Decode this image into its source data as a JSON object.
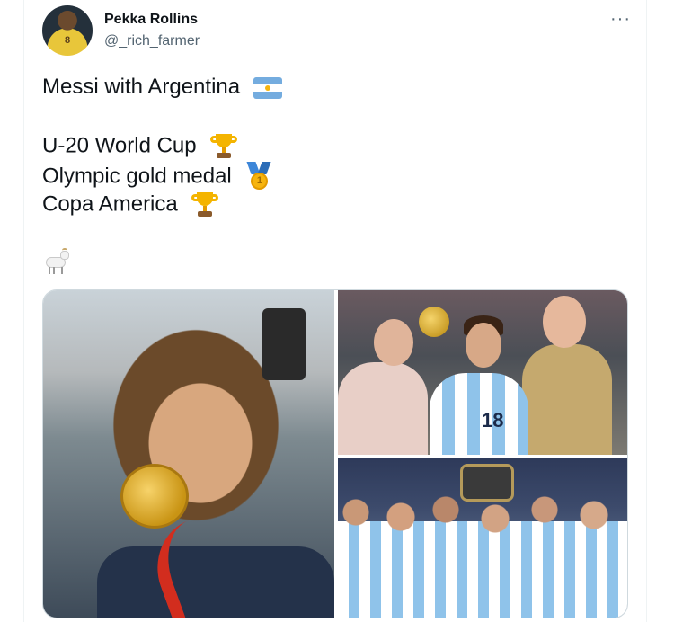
{
  "author": {
    "display_name": "Pekka Rollins",
    "handle": "@_rich_farmer",
    "avatar_jersey_number": "8"
  },
  "menu": {
    "more_label": "···"
  },
  "tweet": {
    "line1": "Messi with Argentina",
    "line2": "U-20 World Cup",
    "line3": "Olympic gold medal",
    "line4": "Copa America",
    "emojis": {
      "line1": "argentina-flag",
      "line2": "trophy",
      "line3": "first-place-medal",
      "line4": "trophy",
      "line5": "goat"
    },
    "medal_number": "1"
  },
  "media": {
    "photos": [
      {
        "id": "photo-1",
        "subject": "messi-kissing-gold-medal"
      },
      {
        "id": "photo-2",
        "subject": "messi-with-u20-trophy"
      },
      {
        "id": "photo-3",
        "subject": "argentina-team-copa-america"
      }
    ],
    "shirt_number": "18"
  },
  "colors": {
    "text": "#0f1419",
    "secondary": "#536471",
    "border": "#cfd9de"
  }
}
